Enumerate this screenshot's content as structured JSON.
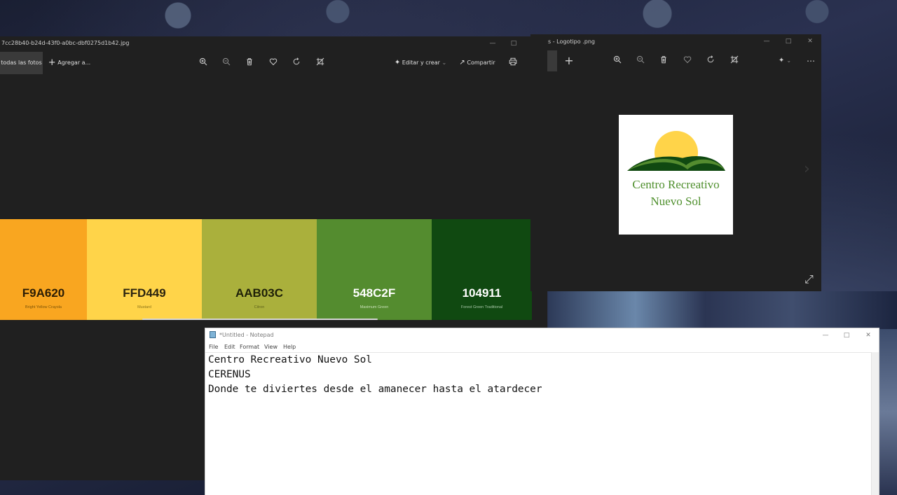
{
  "photos_main": {
    "title": "7cc28b40-b24d-43f0-a0bc-dbf0275d1b42.jpg",
    "all_photos": "todas las fotos",
    "add_to": "Agregar a...",
    "edit_create": "Editar y crear",
    "share": "Compartir",
    "swatches": [
      {
        "hex": "F9A620",
        "name": "Bright Yellow Crayola",
        "bg": "#F9A620",
        "fg": "#2b1d05",
        "sub": "#7a5208"
      },
      {
        "hex": "FFD449",
        "name": "Mustard",
        "bg": "#FFD449",
        "fg": "#2b2410",
        "sub": "#8a7318"
      },
      {
        "hex": "AAB03C",
        "name": "Citron",
        "bg": "#AAB03C",
        "fg": "#1e2008",
        "sub": "#5e611b"
      },
      {
        "hex": "548C2F",
        "name": "Maximum Green",
        "bg": "#548C2F",
        "fg": "#ffffff",
        "sub": "#c9e0b8"
      },
      {
        "hex": "104911",
        "name": "Forest Green Traditional",
        "bg": "#104911",
        "fg": "#ffffff",
        "sub": "#a9c8a9"
      }
    ]
  },
  "photos_logo": {
    "title": "s - Logotipo .png",
    "logo_line1": "Centro Recreativo",
    "logo_line2": "Nuevo Sol"
  },
  "notepad": {
    "title": "*Untitled - Notepad",
    "menu": [
      "File",
      "Edit",
      "Format",
      "View",
      "Help"
    ],
    "lines": [
      "Centro Recreativo Nuevo Sol",
      "CERENUS",
      "Donde te diviertes desde el amanecer hasta el atardecer"
    ]
  },
  "icons": {
    "zoom_in": "zoom-in-icon",
    "zoom_out": "zoom-out-icon",
    "delete": "trash-icon",
    "favorite": "heart-icon",
    "rotate": "rotate-icon",
    "crop": "crop-icon",
    "print": "print-icon",
    "more": "more-icon",
    "expand": "expand-icon"
  }
}
